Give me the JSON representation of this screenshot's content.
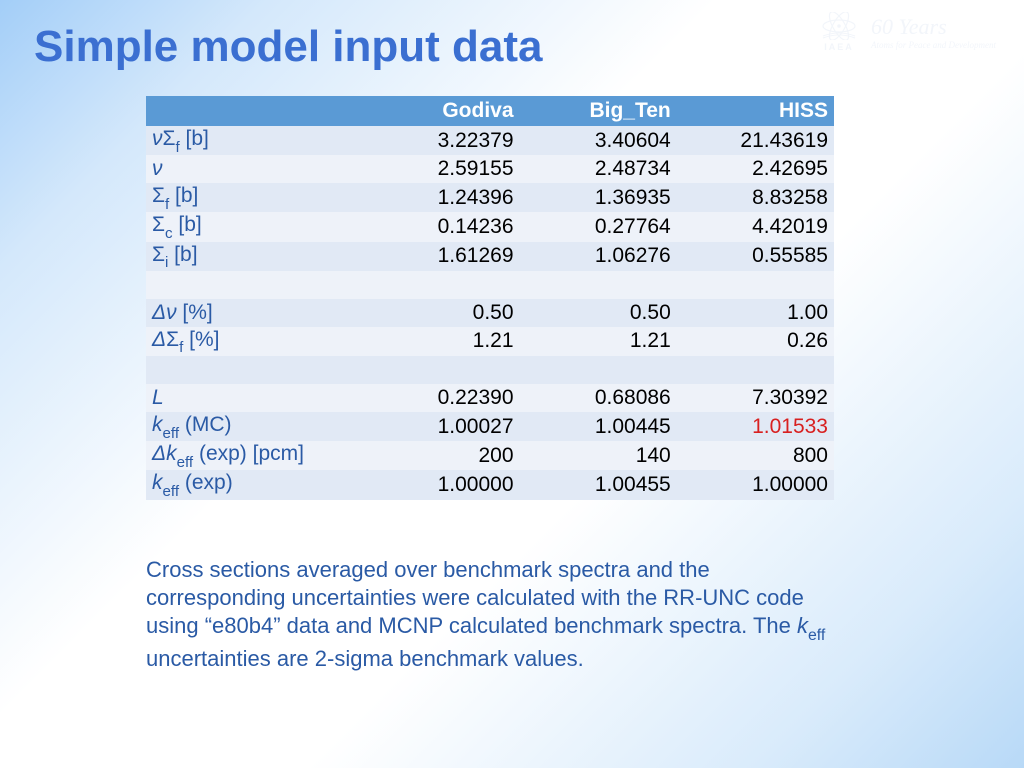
{
  "title": "Simple model input data",
  "logo": {
    "org": "IAEA",
    "years": "60 Years",
    "tagline": "Atoms for Peace and Development"
  },
  "table": {
    "headers": [
      "Godiva",
      "Big_Ten",
      "HISS"
    ],
    "rows": [
      {
        "label_html": "<span class='ital'>ν</span>Σ<span class='sub'>f</span> [b]",
        "v": [
          "3.22379",
          "3.40604",
          "21.43619"
        ]
      },
      {
        "label_html": "<span class='ital'>ν</span>",
        "v": [
          "2.59155",
          "2.48734",
          "2.42695"
        ]
      },
      {
        "label_html": "Σ<span class='sub'>f</span> [b]",
        "v": [
          "1.24396",
          "1.36935",
          "8.83258"
        ]
      },
      {
        "label_html": "Σ<span class='sub'>c</span> [b]",
        "v": [
          "0.14236",
          "0.27764",
          "4.42019"
        ]
      },
      {
        "label_html": "Σ<span class='sub'>i</span> [b]",
        "v": [
          "1.61269",
          "1.06276",
          "0.55585"
        ]
      },
      {
        "label_html": "",
        "v": [
          "",
          "",
          ""
        ]
      },
      {
        "label_html": "<span class='ital'>Δν</span> [%]",
        "v": [
          "0.50",
          "0.50",
          "1.00"
        ]
      },
      {
        "label_html": "<span class='ital'>Δ</span>Σ<span class='sub'>f</span> [%]",
        "v": [
          "1.21",
          "1.21",
          "0.26"
        ]
      },
      {
        "label_html": "",
        "v": [
          "",
          "",
          ""
        ]
      },
      {
        "label_html": "<span class='ital'>L</span>",
        "v": [
          "0.22390",
          "0.68086",
          "7.30392"
        ]
      },
      {
        "label_html": "<span class='ital'>k</span><span class='sub'>eff</span> (MC)",
        "v": [
          "1.00027",
          "1.00445",
          "1.01533"
        ],
        "red_idx": 2
      },
      {
        "label_html": "<span class='ital'>Δk</span><span class='sub'>eff</span> (exp) [pcm]",
        "v": [
          "200",
          "140",
          "800"
        ]
      },
      {
        "label_html": "<span class='ital'>k</span><span class='sub'>eff</span> (exp)",
        "v": [
          "1.00000",
          "1.00455",
          "1.00000"
        ]
      }
    ]
  },
  "caption_html": "Cross sections averaged over benchmark spectra and the corresponding uncertainties were calculated with the RR-UNC code using “e80b4” data and MCNP calculated benchmark spectra. The <span class='ital'>k</span><span class='sub'>eff</span> uncertainties are 2-sigma benchmark values.",
  "chart_data": {
    "type": "table",
    "title": "Simple model input data",
    "columns": [
      "Godiva",
      "Big_Ten",
      "HISS"
    ],
    "rows": [
      {
        "param": "nu*Sigma_f [b]",
        "Godiva": 3.22379,
        "Big_Ten": 3.40604,
        "HISS": 21.43619
      },
      {
        "param": "nu",
        "Godiva": 2.59155,
        "Big_Ten": 2.48734,
        "HISS": 2.42695
      },
      {
        "param": "Sigma_f [b]",
        "Godiva": 1.24396,
        "Big_Ten": 1.36935,
        "HISS": 8.83258
      },
      {
        "param": "Sigma_c [b]",
        "Godiva": 0.14236,
        "Big_Ten": 0.27764,
        "HISS": 4.42019
      },
      {
        "param": "Sigma_i [b]",
        "Godiva": 1.61269,
        "Big_Ten": 1.06276,
        "HISS": 0.55585
      },
      {
        "param": "Delta nu [%]",
        "Godiva": 0.5,
        "Big_Ten": 0.5,
        "HISS": 1.0
      },
      {
        "param": "Delta Sigma_f [%]",
        "Godiva": 1.21,
        "Big_Ten": 1.21,
        "HISS": 0.26
      },
      {
        "param": "L",
        "Godiva": 0.2239,
        "Big_Ten": 0.68086,
        "HISS": 7.30392
      },
      {
        "param": "k_eff (MC)",
        "Godiva": 1.00027,
        "Big_Ten": 1.00445,
        "HISS": 1.01533
      },
      {
        "param": "Delta k_eff (exp) [pcm]",
        "Godiva": 200,
        "Big_Ten": 140,
        "HISS": 800
      },
      {
        "param": "k_eff (exp)",
        "Godiva": 1.0,
        "Big_Ten": 1.00455,
        "HISS": 1.0
      }
    ]
  }
}
